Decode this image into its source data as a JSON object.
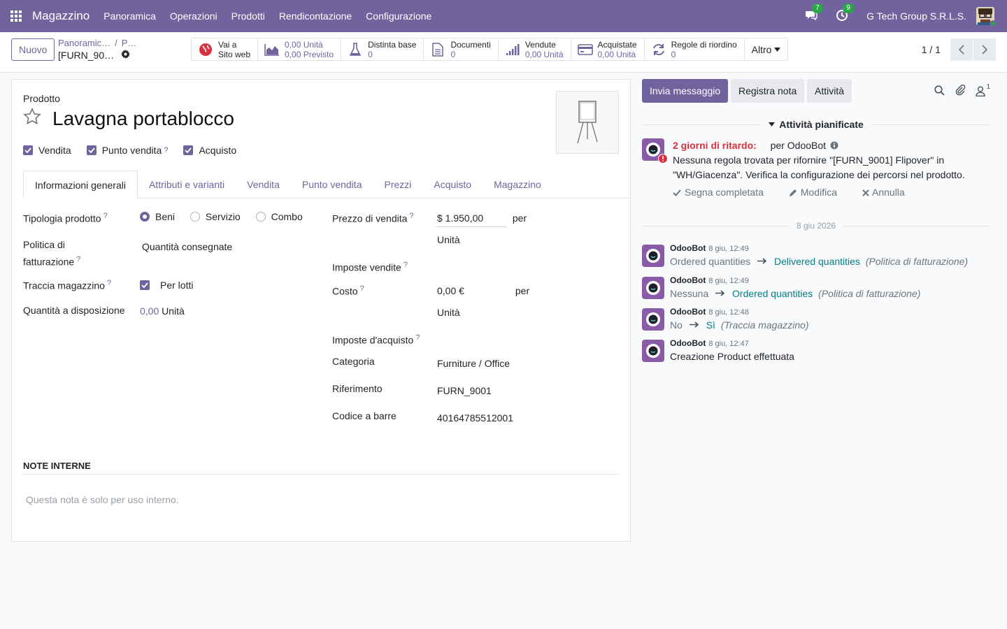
{
  "navbar": {
    "app_name": "Magazzino",
    "menu": [
      "Panoramica",
      "Operazioni",
      "Prodotti",
      "Rendicontazione",
      "Configurazione"
    ],
    "messages_badge": "7",
    "activities_badge": "9",
    "company": "G Tech Group S.R.L.S.",
    "brand_color": "#71639e"
  },
  "control_panel": {
    "new_label": "Nuovo",
    "breadcrumb": [
      "Panoramic…",
      "P…"
    ],
    "record_name": "[FURN_90…",
    "smart_buttons": [
      {
        "icon": "globe-icon",
        "line1": "Vai a",
        "line2": "Sito web"
      },
      {
        "icon": "area-chart-icon",
        "line1": "0,00 Unità",
        "line2": "0,00 Previsto"
      },
      {
        "icon": "flask-icon",
        "line1": "Distinta base",
        "line2": "0"
      },
      {
        "icon": "document-icon",
        "line1": "Documenti",
        "line2": "0"
      },
      {
        "icon": "signal-icon",
        "line1": "Vendute",
        "line2": "0,00 Unità"
      },
      {
        "icon": "credit-card-icon",
        "line1": "Acquistate",
        "line2": "0,00 Unità"
      },
      {
        "icon": "refresh-icon",
        "line1": "Regole di riordino",
        "line2": "0"
      }
    ],
    "more_label": "Altro",
    "pager": "1 / 1"
  },
  "form": {
    "type_label": "Prodotto",
    "title": "Lavagna portablocco",
    "checkboxes": [
      {
        "label": "Vendita",
        "checked": true,
        "help": false
      },
      {
        "label": "Punto vendita",
        "checked": true,
        "help": true
      },
      {
        "label": "Acquisto",
        "checked": true,
        "help": false
      }
    ],
    "tabs": [
      "Informazioni generali",
      "Attributi e varianti",
      "Vendita",
      "Punto vendita",
      "Prezzi",
      "Acquisto",
      "Magazzino"
    ],
    "left": {
      "product_type_label": "Tipologia prodotto",
      "product_type_options": [
        "Beni",
        "Servizio",
        "Combo"
      ],
      "product_type_selected": "Beni",
      "invoice_policy_label": "Politica di fatturazione",
      "invoice_policy_value": "Quantità consegnate",
      "track_inventory_label": "Traccia magazzino",
      "track_inventory_value": "Per lotti",
      "qty_label": "Quantità a disposizione",
      "qty_value": "0,00",
      "qty_unit": "Unità"
    },
    "right": {
      "sale_price_label": "Prezzo di vendita",
      "sale_price_value": "$ 1.950,00",
      "per": "per",
      "unit": "Unità",
      "sales_taxes_label": "Imposte vendite",
      "cost_label": "Costo",
      "cost_value": "0,00 €",
      "purchase_taxes_label": "Imposte d'acquisto",
      "category_label": "Categoria",
      "category_value": "Furniture / Office",
      "reference_label": "Riferimento",
      "reference_value": "FURN_9001",
      "barcode_label": "Codice a barre",
      "barcode_value": "40164785512001"
    },
    "notes_title": "NOTE INTERNE",
    "notes_placeholder": "Questa nota è solo per uso interno."
  },
  "chatter": {
    "send_message": "Invia messaggio",
    "log_note": "Registra nota",
    "activities": "Attività",
    "followers_count": "1",
    "planned_title": "Attività pianificate",
    "activity": {
      "late_label": "2 giorni di ritardo:",
      "for_label": "per OdooBot",
      "text": "Nessuna regola trovata per rifornire \"[FURN_9001] Flipover\" in \"WH/Giacenza\". Verifica la configurazione dei percorsi nel prodotto.",
      "done_label": "Segna completata",
      "edit_label": "Modifica",
      "cancel_label": "Annulla"
    },
    "date_separator": "8 giu 2026",
    "messages": [
      {
        "author": "OdooBot",
        "time": "8 giu, 12:49",
        "old": "Ordered quantities",
        "new": "Delivered quantities",
        "field": "(Politica di fatturazione)"
      },
      {
        "author": "OdooBot",
        "time": "8 giu, 12:49",
        "old": "Nessuna",
        "new": "Ordered quantities",
        "field": "(Politica di fatturazione)"
      },
      {
        "author": "OdooBot",
        "time": "8 giu, 12:48",
        "old": "No",
        "new": "Sì",
        "field": "(Traccia magazzino)"
      },
      {
        "author": "OdooBot",
        "time": "8 giu, 12:47",
        "text": "Creazione Product effettuata"
      }
    ]
  }
}
